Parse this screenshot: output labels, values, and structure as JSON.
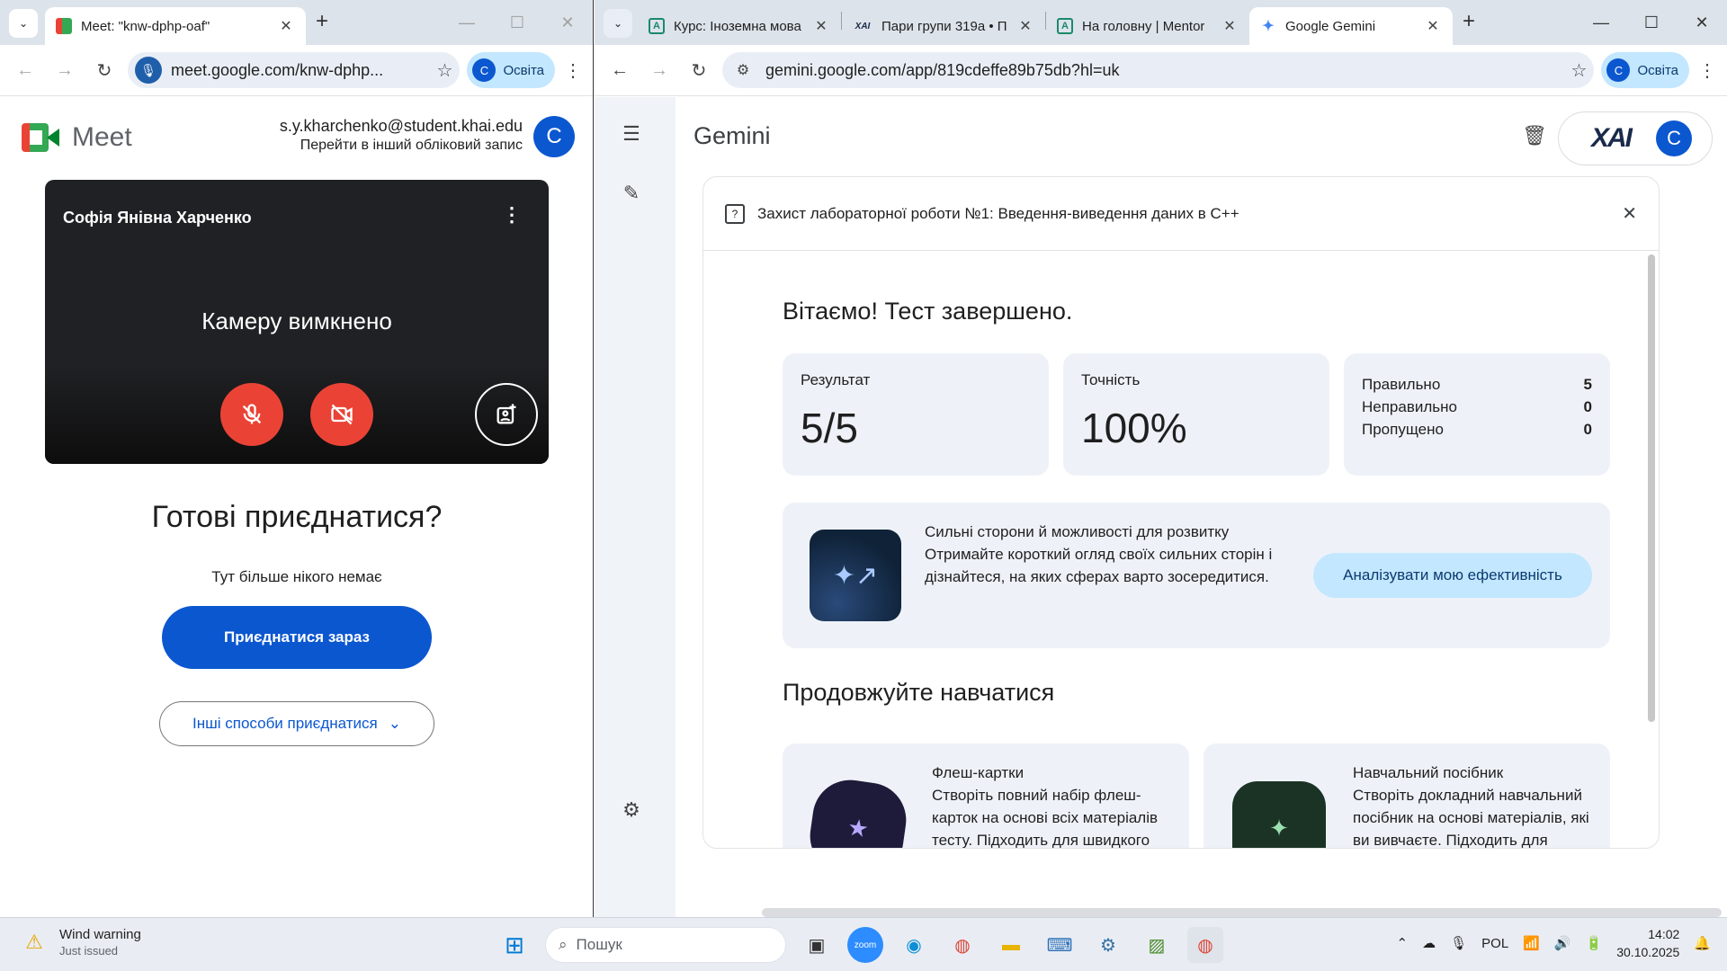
{
  "left_window": {
    "tab": {
      "title": "Meet: \"knw-dphp-oaf\""
    },
    "url": "meet.google.com/knw-dphp...",
    "profile_label": "Освіта",
    "profile_initial": "C"
  },
  "meet": {
    "logo_text": "Meet",
    "email": "s.y.kharchenko@student.khai.edu",
    "switch_account": "Перейти в інший обліковий запис",
    "avatar_initial": "C",
    "participant_name": "Софія Янівна Харченко",
    "camera_off": "Камеру вимкнено",
    "ready_heading": "Готові приєднатися?",
    "nobody_here": "Тут більше нікого немає",
    "join_now": "Приєднатися зараз",
    "other_ways": "Інші способи приєднатися"
  },
  "right_window": {
    "tabs": [
      {
        "title": "Курс: Іноземна мова",
        "favicon": "A"
      },
      {
        "title": "Пари групи 319а • П",
        "favicon": "XAI"
      },
      {
        "title": "На головну | Mentor",
        "favicon": "A"
      },
      {
        "title": "Google Gemini",
        "favicon": "✦"
      }
    ],
    "url": "gemini.google.com/app/819cdeffe89b75db?hl=uk",
    "profile_label": "Освіта",
    "profile_initial": "C"
  },
  "gemini": {
    "title": "Gemini",
    "logo_text": "XAI",
    "avatar_initial": "C",
    "quiz_title": "Захист лабораторної роботи №1: Введення-виведення даних в C++",
    "congrats": "Вітаємо! Тест завершено.",
    "result_label": "Результат",
    "result_value": "5/5",
    "accuracy_label": "Точність",
    "accuracy_value": "100%",
    "stats": [
      {
        "label": "Правильно",
        "value": "5"
      },
      {
        "label": "Неправильно",
        "value": "0"
      },
      {
        "label": "Пропущено",
        "value": "0"
      }
    ],
    "strength_title": "Сильні сторони й можливості для розвитку",
    "strength_text": "Отримайте короткий огляд своїх сильних сторін і дізнайтеся, на яких сферах варто зосередитися.",
    "analyze_button": "Аналізувати мою ефективність",
    "continue_heading": "Продовжуйте навчатися",
    "cards": [
      {
        "title": "Флеш-картки",
        "text": "Створіть повний набір флеш-карток на основі всіх матеріалів тесту. Підходить для швидкого повторення й засвоєння"
      },
      {
        "title": "Навчальний посібник",
        "text": "Створіть докладний навчальний посібник на основі матеріалів, які ви вивчаєте. Підходить для детального повторення"
      }
    ]
  },
  "taskbar": {
    "weather_title": "Wind warning",
    "weather_sub": "Just issued",
    "search_placeholder": "Пошук",
    "lang": "POL",
    "time": "14:02",
    "date": "30.10.2025"
  }
}
